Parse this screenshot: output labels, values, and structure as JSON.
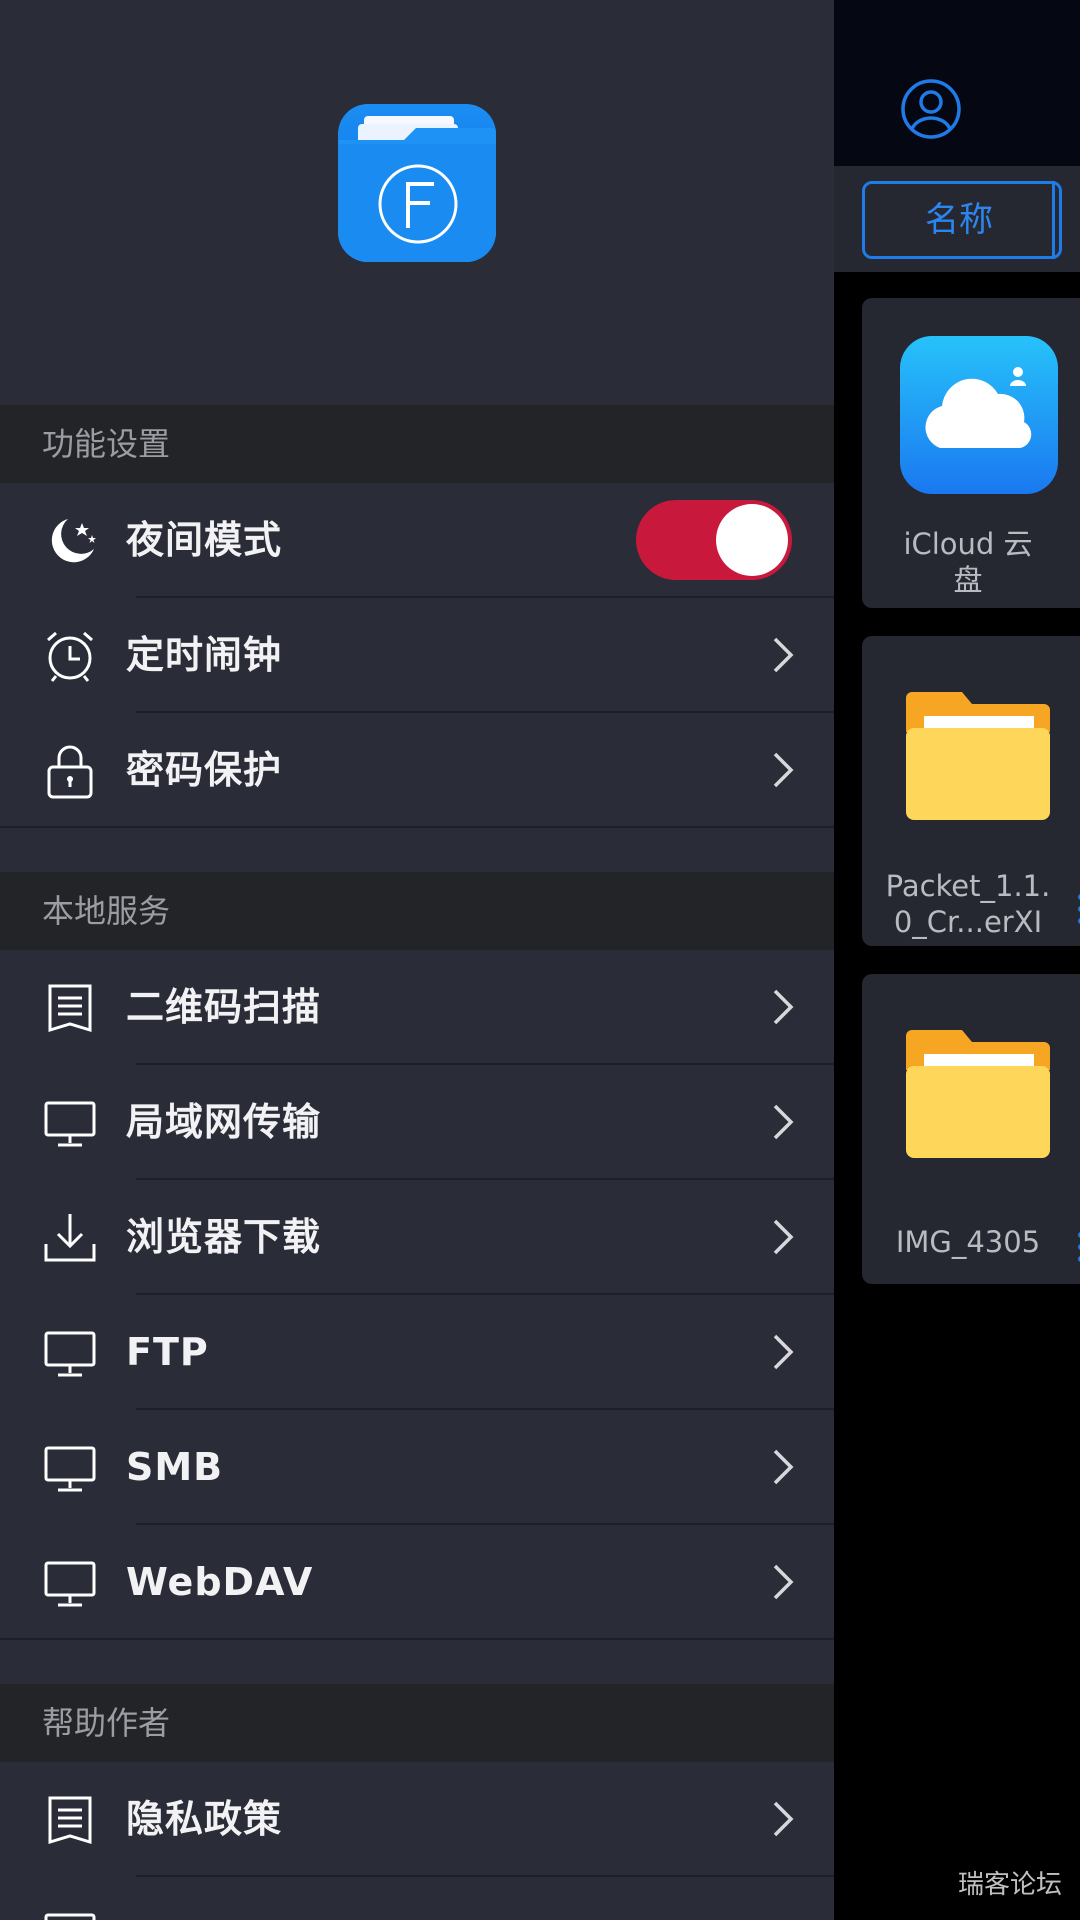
{
  "drawer": {
    "sections": {
      "features": "功能设置",
      "local_services": "本地服务",
      "help_author": "帮助作者"
    },
    "items": {
      "night_mode": "夜间模式",
      "timer_alarm": "定时闹钟",
      "password": "密码保护",
      "qr_scan": "二维码扫描",
      "lan": "局域网传输",
      "browser_download": "浏览器下载",
      "ftp": "FTP",
      "smb": "SMB",
      "webdav": "WebDAV",
      "privacy": "隐私政策"
    },
    "night_mode_on": true
  },
  "content": {
    "sort_label": "名称",
    "cards": [
      {
        "label_line1": "iCloud 云",
        "label_line2": "盘"
      },
      {
        "label_line1": "Packet_1.1.",
        "label_line2": "0_Cr...erXI"
      },
      {
        "label_line1": "IMG_4305",
        "label_line2": ""
      }
    ]
  },
  "watermark": "瑞客论坛"
}
